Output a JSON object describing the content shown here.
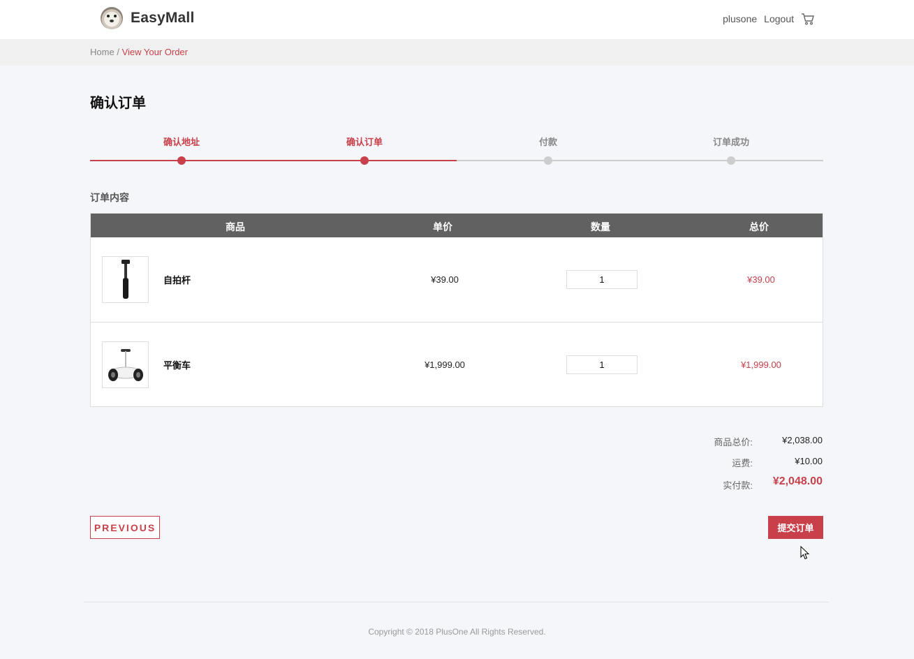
{
  "header": {
    "brand": "EasyMall",
    "username": "plusone",
    "logout_label": "Logout",
    "cart_icon": "cart-icon"
  },
  "breadcrumb": {
    "home": "Home",
    "separator": "/",
    "current": "View Your Order"
  },
  "page_title": "确认订单",
  "steps": [
    {
      "label": "确认地址",
      "state": "done"
    },
    {
      "label": "确认订单",
      "state": "done"
    },
    {
      "label": "付款",
      "state": "pending"
    },
    {
      "label": "订单成功",
      "state": "pending"
    }
  ],
  "section_title": "订单内容",
  "table": {
    "columns": [
      "商品",
      "单价",
      "数量",
      "总价"
    ],
    "rows": [
      {
        "name": "自拍杆",
        "unit_price": "¥39.00",
        "quantity": "1",
        "total": "¥39.00",
        "image_icon": "selfie-stick-image"
      },
      {
        "name": "平衡车",
        "unit_price": "¥1,999.00",
        "quantity": "1",
        "total": "¥1,999.00",
        "image_icon": "balance-scooter-image"
      }
    ]
  },
  "summary": {
    "subtotal_label": "商品总价:",
    "subtotal_value": "¥2,038.00",
    "shipping_label": "运费:",
    "shipping_value": "¥10.00",
    "final_label": "实付款:",
    "final_value": "¥2,048.00"
  },
  "buttons": {
    "previous": "PREVIOUS",
    "submit": "提交订单"
  },
  "footer": {
    "copyright": "Copyright © 2018 PlusOne All Rights Reserved."
  },
  "colors": {
    "accent": "#c8404a",
    "table_header": "#616161",
    "background": "#f5f6fa"
  }
}
